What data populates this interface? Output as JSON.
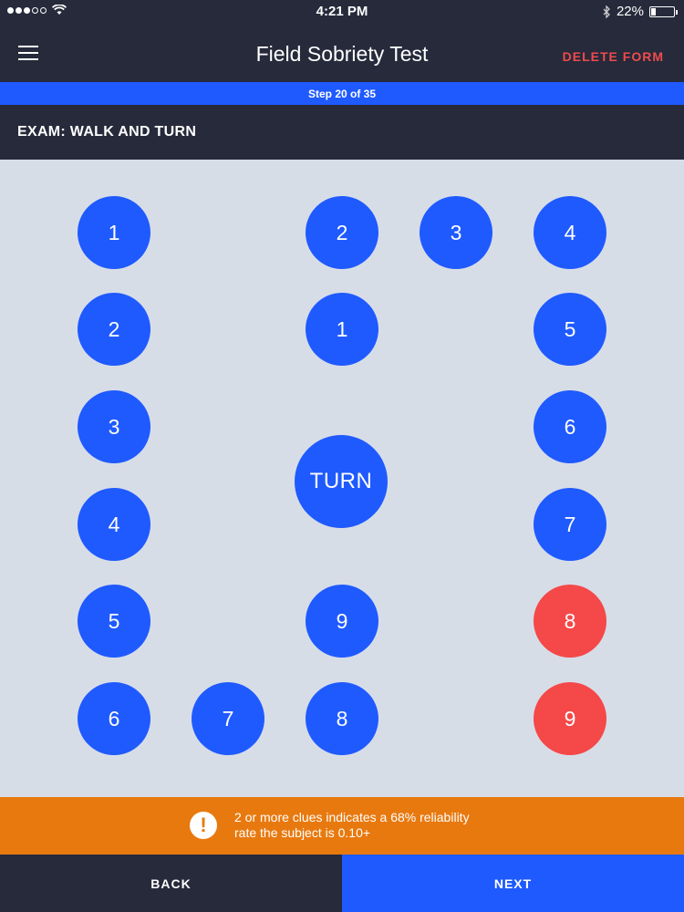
{
  "status_bar": {
    "time": "4:21 PM",
    "battery_text": "22%",
    "battery_level": 0.22,
    "signal_bars": 3,
    "icons": [
      "signal-icon",
      "wifi-icon",
      "bluetooth-icon",
      "battery-icon"
    ]
  },
  "header": {
    "menu_icon": "hamburger-menu-icon",
    "title": "Field Sobriety Test",
    "delete_label": "DELETE FORM"
  },
  "progress": {
    "label": "Step 20 of 35",
    "current": 20,
    "total": 35
  },
  "section": {
    "title": "EXAM: WALK AND TURN"
  },
  "steps": {
    "out_1": "1",
    "out_2": "2",
    "out_3": "3",
    "out_4": "4",
    "out_5": "5",
    "out_6": "6",
    "mid_7": "7",
    "mid_8": "8",
    "mid_9": "9",
    "top_1": "1",
    "top_2": "2",
    "top_3": "3",
    "turn": "TURN",
    "ret_4": "4",
    "ret_5": "5",
    "ret_6": "6",
    "ret_7": "7",
    "ret_8": "8",
    "ret_9": "9"
  },
  "colors": {
    "step_normal": "#1f5aff",
    "step_clue": "#f54848",
    "notice": "#e8790f",
    "header_bg": "#262a3b"
  },
  "notice": {
    "icon": "alert-icon",
    "line1": "2 or more clues indicates a 68% reliability",
    "line2": "rate the subject is 0.10+"
  },
  "footer": {
    "back_label": "BACK",
    "next_label": "NEXT"
  }
}
